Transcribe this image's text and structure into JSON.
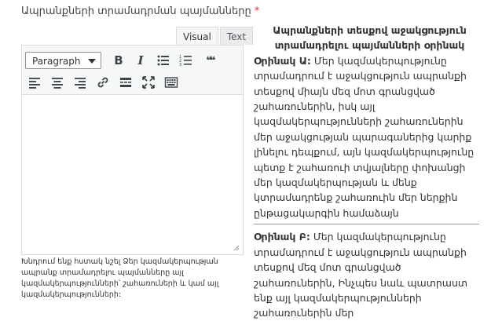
{
  "field": {
    "label": "Ապրանքների տրամադրման պայմանները",
    "required_mark": "*"
  },
  "editor": {
    "tabs": [
      "Visual",
      "Text"
    ],
    "format_selected": "Paragraph",
    "toolbar_icons": [
      "bold-icon",
      "italic-icon",
      "bullet-list-icon",
      "numbered-list-icon",
      "blockquote-icon",
      "align-left-icon",
      "align-center-icon",
      "align-right-icon",
      "link-icon",
      "more-icon",
      "fullscreen-icon",
      "toolbar-toggle-icon"
    ],
    "bold_glyph": "B",
    "italic_glyph": "I",
    "quote_glyph": "❝❝",
    "content": ""
  },
  "help_text": "Խնդրում ենք հստակ նշել Ձեր կազմակերպության ապրանք տրամադրելու պայմանները այլ կազմակերպությունների՝ շահառուների և կամ այլ կազմակերպությունների:",
  "sidebar": {
    "title": "Ապրանքների տեսքով աջակցություն տրամադրելու պայմանների օրինակ",
    "example_a_label": "Օրինակ Ա:",
    "example_a_text": " Մեր կազմակերպությունը տրամադրում է աջակցություն ապրանքի տեսքով միայն մեզ մոտ գրանցված շահառուներին, իսկ այլ կազմակերպությունների շահառուներին մեր աջակցության պարագաներից կարիք լինելու դեպքում, այն կազմակերպությունը պետք է շահառուի տվյալները փոխանցի մեր կազմակերպության և մենք կտրամադրենք շահառուին մեր ներքին ընթացակարգին համաձայն",
    "example_b_label": "Օրինակ Բ:",
    "example_b_text": " Մեր կազմակերպությունը տրամադրում է աջակցություն ապրանքի տեսքով մեզ մոտ գրանցված շահառուներին, Ինչպես նաև պատրաստ ենք այլ կազմակերպությունների շահառուներին մեր"
  }
}
